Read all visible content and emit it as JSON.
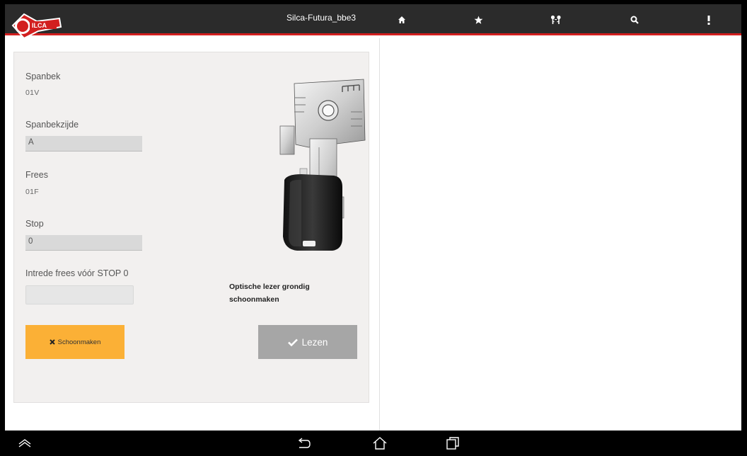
{
  "header": {
    "logo_text": "SILCA",
    "title": "Silca-Futura_bbe3",
    "icons": [
      "home-icon",
      "star-icon",
      "keys-icon",
      "search-icon",
      "more-icon"
    ]
  },
  "panel": {
    "spanbek_label": "Spanbek",
    "spanbek_value": "01V",
    "spanbekzijde_label": "Spanbekzijde",
    "spanbekzijde_value": "A",
    "frees_label": "Frees",
    "frees_value": "01F",
    "stop_label": "Stop",
    "stop_value": "0",
    "intrede_label": "Intrede frees vóór STOP 0",
    "intrede_value": "",
    "note": "Optische lezer grondig schoonmaken",
    "clean_button": "Schoonmaken",
    "read_button": "Lezen"
  },
  "navbar": {
    "icons": [
      "recent-apps-up-icon",
      "back-icon",
      "home-nav-icon",
      "recents-icon"
    ]
  },
  "colors": {
    "topbar": "#2b2b2b",
    "accent_red": "#d21f1f",
    "clean_button": "#fbb036",
    "read_button": "#a6a6a6"
  }
}
